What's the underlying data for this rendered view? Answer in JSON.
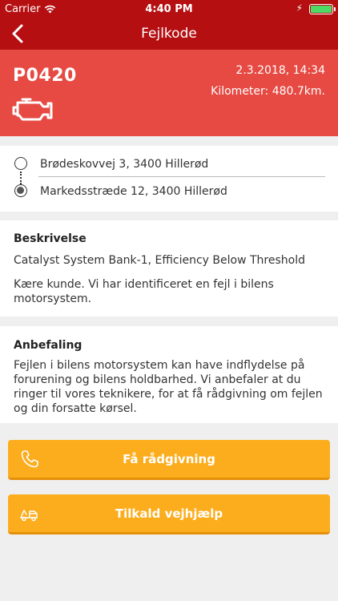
{
  "status_bar": {
    "carrier": "Carrier",
    "time": "4:40 PM"
  },
  "nav": {
    "title": "Fejlkode",
    "back_icon": "chevron-left-icon"
  },
  "fault": {
    "code": "P0420",
    "icon": "engine-icon",
    "date": "2.3.2018, 14:34",
    "mileage": "Kilometer: 480.7km."
  },
  "route": {
    "start_address": "Brødeskovvej 3, 3400 Hillerød",
    "end_address": "Markedsstræde 12, 3400 Hillerød"
  },
  "description": {
    "title": "Beskrivelse",
    "text1": "Catalyst System Bank-1, Efficiency Below Threshold",
    "text2": "Kære kunde. Vi har identificeret en fejl i bilens motorsystem."
  },
  "recommendation": {
    "title": "Anbefaling",
    "text": "Fejlen i bilens motorsystem kan have indflydelse på forurening og bilens holdbarhed. Vi anbefaler at du ringer til vores teknikere, for at få rådgivning om fejlen og din forsatte kørsel."
  },
  "actions": {
    "advice_label": "Få rådgivning",
    "advice_icon": "phone-icon",
    "roadside_label": "Tilkald vejhjælp",
    "roadside_icon": "tow-truck-icon"
  },
  "colors": {
    "nav_bar": "#b50f12",
    "hero": "#e64a43",
    "button": "#fcad1d",
    "background": "#efefef"
  }
}
